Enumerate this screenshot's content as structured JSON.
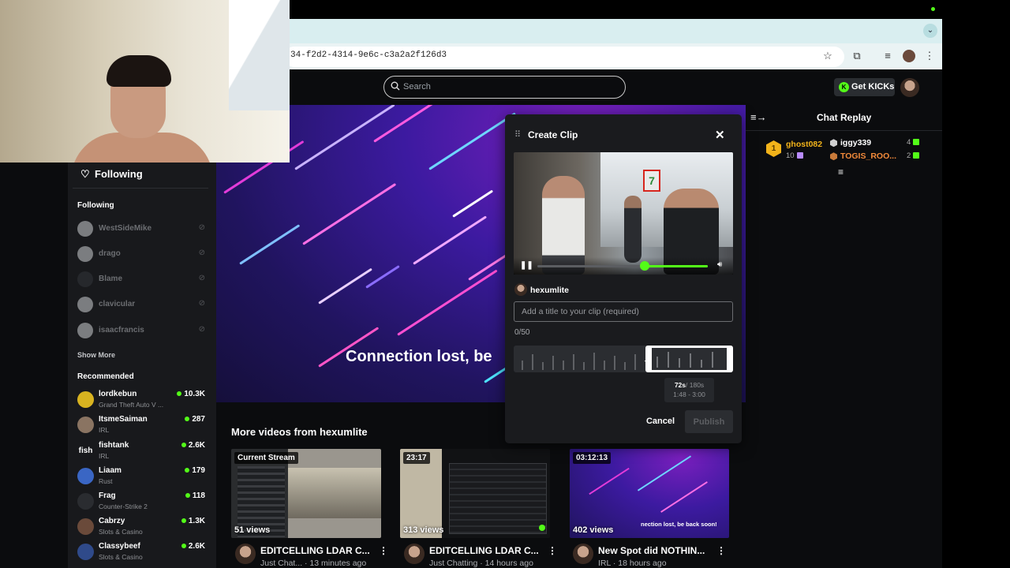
{
  "browser": {
    "url_fragment": "34-f2d2-4314-9e6c-c3a2a2f126d3",
    "icons": [
      "star-icon",
      "extensions-icon",
      "media-icon",
      "profile-icon",
      "menu-icon"
    ]
  },
  "header": {
    "search_placeholder": "Search",
    "get_kicks_label": "Get KICKs"
  },
  "sidebar": {
    "following_header": "Following",
    "following_section": "Following",
    "following": [
      {
        "name": "WestSideMike"
      },
      {
        "name": "drago"
      },
      {
        "name": "Blame"
      },
      {
        "name": "clavicular"
      },
      {
        "name": "isaacfrancis"
      }
    ],
    "show_more": "Show More",
    "recommended_section": "Recommended",
    "recommended": [
      {
        "name": "lordkebun",
        "category": "Grand Theft Auto V ...",
        "viewers": "10.3K"
      },
      {
        "name": "ItsmeSaiman",
        "category": "IRL",
        "viewers": "287"
      },
      {
        "name": "fishtank",
        "category": "IRL",
        "viewers": "2.6K"
      },
      {
        "name": "Liaam",
        "category": "Rust",
        "viewers": "179"
      },
      {
        "name": "Frag",
        "category": "Counter-Strike 2",
        "viewers": "118"
      },
      {
        "name": "Cabrzy",
        "category": "Slots & Casino",
        "viewers": "1.3K"
      },
      {
        "name": "Classybeef",
        "category": "Slots & Casino",
        "viewers": "2.6K"
      }
    ]
  },
  "player": {
    "overlay_text": "Connection lost, be"
  },
  "chat": {
    "title": "Chat Replay",
    "row": {
      "user1": "ghost082",
      "user1_count": "10",
      "user2": "iggy339",
      "user2_count": "4",
      "user3": "TOGIS_ROO...",
      "user3_count": "2",
      "rank_badge": "1"
    }
  },
  "modal": {
    "title": "Create Clip",
    "creator": "hexumlite",
    "title_placeholder": "Add a title to your clip (required)",
    "counter": "0/50",
    "duration_value": "72s",
    "duration_max": "/ 180s",
    "range": "1:48 - 3:00",
    "cancel_label": "Cancel",
    "publish_label": "Publish",
    "store_sign": "7",
    "playback_progress": 0.63
  },
  "more_videos": {
    "title": "More videos from hexumlite",
    "items": [
      {
        "tag": "Current Stream",
        "views": "51 views",
        "title": "EDITCELLING LDAR C...",
        "subtitle": "Just Chat... · 13 minutes ago"
      },
      {
        "tag": "23:17",
        "views": "313 views",
        "title": "EDITCELLING LDAR C...",
        "subtitle": "Just Chatting · 14 hours ago"
      },
      {
        "tag": "03:12:13",
        "views": "402 views",
        "title": "New Spot did NOTHIN...",
        "subtitle": "IRL · 18 hours ago",
        "thumb_text": "nection lost, be back soon!"
      }
    ]
  },
  "colors": {
    "accent": "#53fc18",
    "background": "#0b0c0e",
    "sidebar": "#18191c",
    "modal": "#1a1b1e"
  }
}
